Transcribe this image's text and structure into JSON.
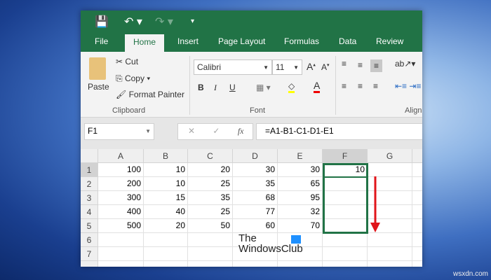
{
  "quick_access": {
    "save": "save-icon",
    "undo": "undo-icon",
    "redo": "redo-icon"
  },
  "tabs": [
    "File",
    "Home",
    "Insert",
    "Page Layout",
    "Formulas",
    "Data",
    "Review"
  ],
  "clipboard": {
    "paste": "Paste",
    "cut": "Cut",
    "copy": "Copy",
    "format_painter": "Format Painter",
    "group": "Clipboard"
  },
  "font": {
    "name": "Calibri",
    "size": "11",
    "bold": "B",
    "italic": "I",
    "underline": "U",
    "group": "Font"
  },
  "alignment": {
    "group": "Align"
  },
  "formula_bar": {
    "name_box": "F1",
    "fx": "fx",
    "formula": "=A1-B1-C1-D1-E1"
  },
  "columns": [
    "A",
    "B",
    "C",
    "D",
    "E",
    "F",
    "G"
  ],
  "rows": [
    "1",
    "2",
    "3",
    "4",
    "5",
    "6",
    "7"
  ],
  "cells": [
    [
      "100",
      "10",
      "20",
      "30",
      "30",
      "10"
    ],
    [
      "200",
      "10",
      "25",
      "35",
      "65",
      ""
    ],
    [
      "300",
      "15",
      "35",
      "68",
      "95",
      ""
    ],
    [
      "400",
      "40",
      "25",
      "77",
      "32",
      ""
    ],
    [
      "500",
      "20",
      "50",
      "60",
      "70",
      ""
    ]
  ],
  "watermark": {
    "line1": "The",
    "line2": "WindowsClub"
  },
  "site": "wsxdn.com",
  "colors": {
    "excel_green": "#217346",
    "arrow": "#e0141a"
  }
}
